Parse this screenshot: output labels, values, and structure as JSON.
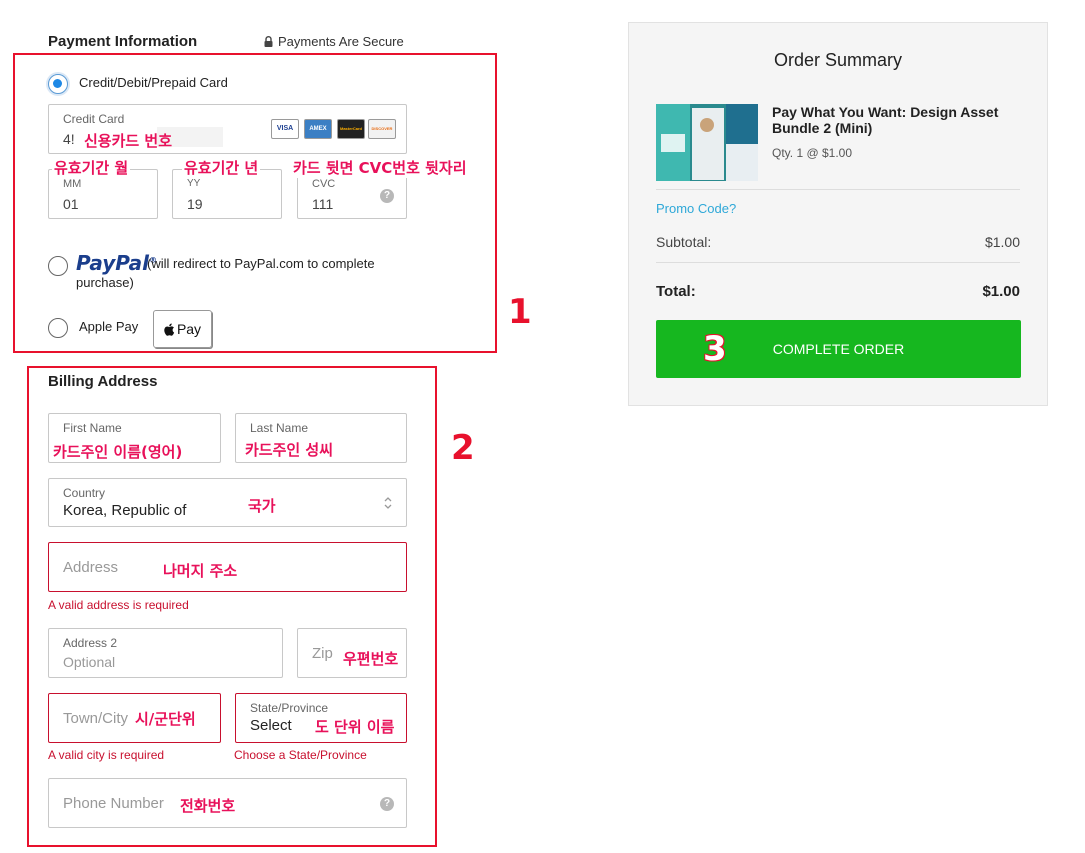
{
  "payment": {
    "title": "Payment Information",
    "secure_text": "Payments Are Secure",
    "card_option": "Credit/Debit/Prepaid Card",
    "card_field": {
      "label": "Credit Card",
      "value": "4!",
      "annotation": "신용카드 번호"
    },
    "card_logos": [
      "VISA",
      "AMEX",
      "MasterCard",
      "DISCOVER"
    ],
    "mm": {
      "label": "MM",
      "value": "01",
      "annotation": "유효기간 월"
    },
    "yy": {
      "label": "YY",
      "value": "19",
      "annotation": "유효기간 년"
    },
    "cvc": {
      "label": "CVC",
      "value": "111",
      "annotation": "카드 뒷면 CVC번호 뒷자리"
    },
    "paypal_logo": "PayPal",
    "paypal_text": "(will redirect to PayPal.com to complete",
    "paypal_text2": "purchase)",
    "applepay_label": "Apple Pay",
    "applepay_button": "Pay",
    "step": "1"
  },
  "billing": {
    "title": "Billing Address",
    "first_name": {
      "label": "First Name",
      "annotation": "카드주인 이름(영어)"
    },
    "last_name": {
      "label": "Last Name",
      "annotation": "카드주인 성씨"
    },
    "country": {
      "label": "Country",
      "value": "Korea, Republic of",
      "annotation": "국가"
    },
    "address": {
      "placeholder": "Address",
      "annotation": "나머지 주소",
      "error": "A valid address is required"
    },
    "address2": {
      "label": "Address 2",
      "placeholder": "Optional"
    },
    "zip": {
      "placeholder": "Zip",
      "annotation": "우편번호"
    },
    "city": {
      "placeholder": "Town/City",
      "annotation": "시/군단위",
      "error": "A valid city is required"
    },
    "state": {
      "label": "State/Province",
      "value": "Select",
      "annotation": "도 단위 이름",
      "error": "Choose a State/Province"
    },
    "phone": {
      "placeholder": "Phone Number",
      "annotation": "전화번호"
    },
    "step": "2"
  },
  "summary": {
    "title": "Order Summary",
    "product_name": "Pay What You Want: Design Asset Bundle 2 (Mini)",
    "qty": "Qty. 1 @ $1.00",
    "promo": "Promo Code?",
    "subtotal_label": "Subtotal:",
    "subtotal_value": "$1.00",
    "total_label": "Total:",
    "total_value": "$1.00",
    "complete_button": "COMPLETE ORDER",
    "step": "3"
  },
  "colors": {
    "annotation_red": "#e8112d",
    "annotation_pink": "#e8115a",
    "error_red": "#c8102e",
    "button_green": "#16b71f",
    "promo_blue": "#2ea8d8"
  }
}
